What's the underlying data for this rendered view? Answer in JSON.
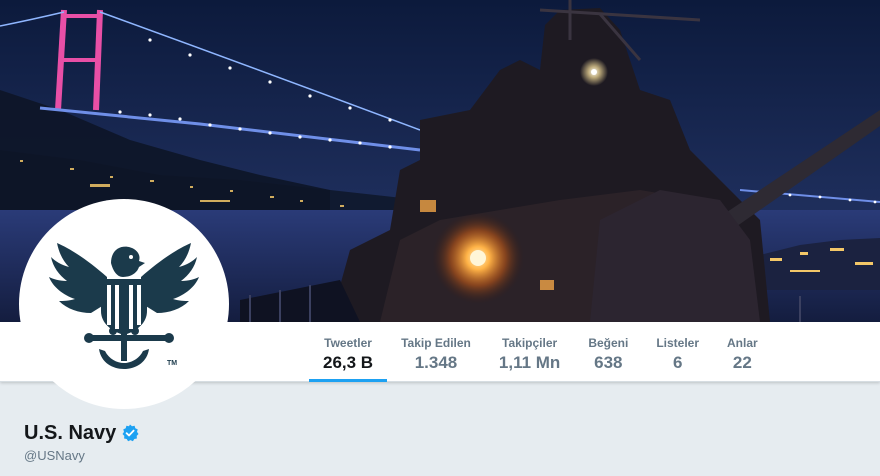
{
  "header": {
    "description": "Navy destroyer at night under the illuminated Bosphorus Bridge"
  },
  "profile": {
    "name": "U.S. Navy",
    "screen_name": "@USNavy",
    "verified": true,
    "avatar_icon": "navy-eagle-anchor-emblem"
  },
  "nav": {
    "items": [
      {
        "label": "Tweetler",
        "value": "26,3 B",
        "active": true
      },
      {
        "label": "Takip Edilen",
        "value": "1.348",
        "active": false
      },
      {
        "label": "Takipçiler",
        "value": "1,11 Mn",
        "active": false
      },
      {
        "label": "Beğeni",
        "value": "638",
        "active": false
      },
      {
        "label": "Listeler",
        "value": "6",
        "active": false
      },
      {
        "label": "Anlar",
        "value": "22",
        "active": false
      }
    ]
  },
  "colors": {
    "accent": "#1da1f2",
    "emblem": "#1b3a4b",
    "text_primary": "#14171a",
    "text_secondary": "#657786"
  }
}
